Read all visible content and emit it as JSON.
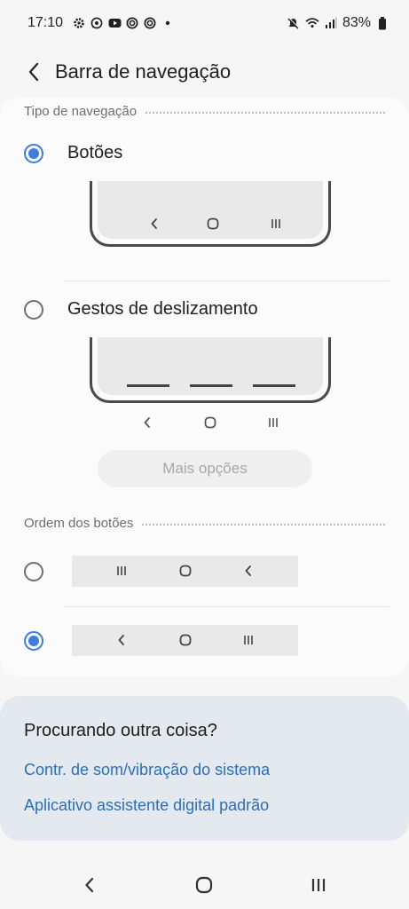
{
  "status_bar": {
    "time": "17:10",
    "left_icons": [
      "gear-icon",
      "whatsapp-icon",
      "youtube-icon",
      "sync-icon",
      "sync-icon",
      "dot-icon"
    ],
    "battery_percent": "83%",
    "right_icons": [
      "mute-icon",
      "wifi-icon",
      "signal-icon",
      "battery-icon"
    ]
  },
  "app_bar": {
    "title": "Barra de navegação"
  },
  "navigation_type": {
    "header": "Tipo de navegação",
    "options": [
      {
        "label": "Botões",
        "checked": true
      },
      {
        "label": "Gestos de deslizamento",
        "checked": false
      }
    ],
    "more_options_label": "Mais opções"
  },
  "button_order": {
    "header": "Ordem dos botões",
    "options": [
      {
        "order": [
          "recents-icon",
          "home-icon",
          "back-icon"
        ],
        "checked": false
      },
      {
        "order": [
          "back-icon",
          "home-icon",
          "recents-icon"
        ],
        "checked": true
      }
    ]
  },
  "help": {
    "title": "Procurando outra coisa?",
    "links": [
      "Contr. de som/vibração do sistema",
      "Aplicativo assistente digital padrão"
    ]
  },
  "colors": {
    "accent": "#3e7ddb",
    "link": "#2a6fb8",
    "background": "#f6f6f6",
    "card": "#fbfbfb",
    "help_card": "#e4e9ef"
  }
}
